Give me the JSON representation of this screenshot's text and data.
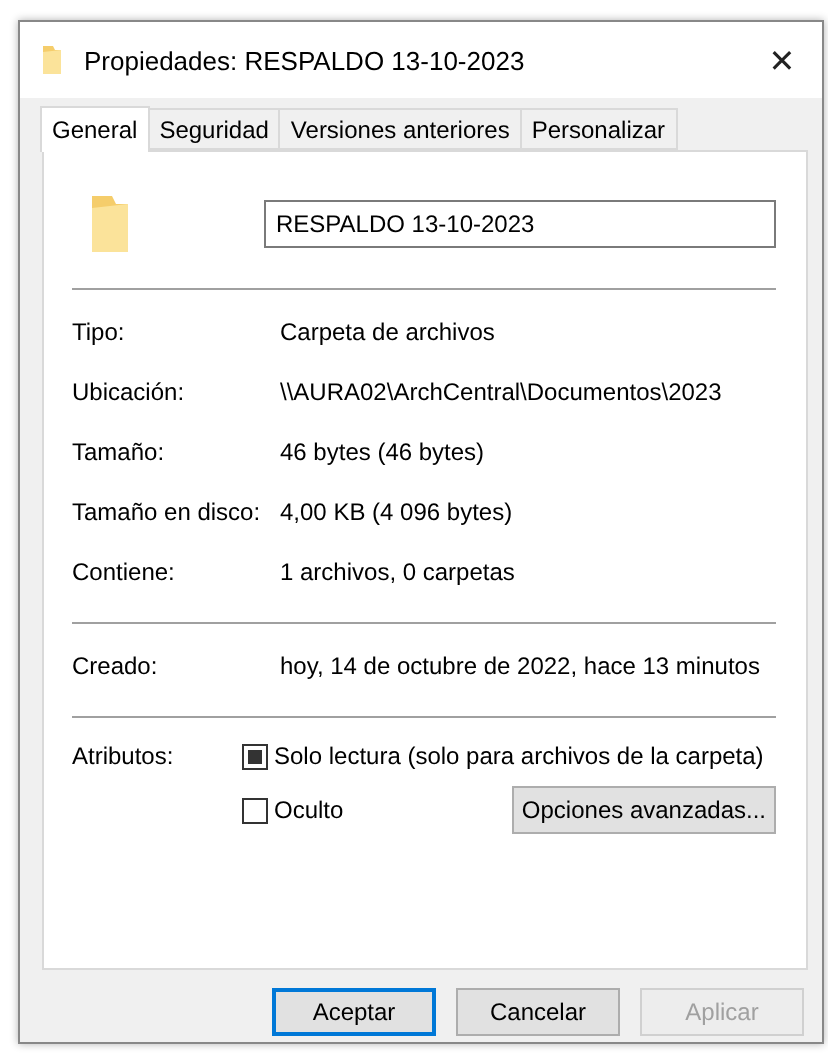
{
  "window": {
    "title": "Propiedades: RESPALDO 13-10-2023",
    "close": "✕"
  },
  "tabs": [
    {
      "label": "General",
      "selected": true
    },
    {
      "label": "Seguridad",
      "selected": false
    },
    {
      "label": "Versiones anteriores",
      "selected": false
    },
    {
      "label": "Personalizar",
      "selected": false
    }
  ],
  "name_field": {
    "value": "RESPALDO 13-10-2023"
  },
  "properties": [
    {
      "label": "Tipo:",
      "value": "Carpeta de archivos"
    },
    {
      "label": "Ubicación:",
      "value": "\\\\AURA02\\ArchCentral\\Documentos\\2023"
    },
    {
      "label": "Tamaño:",
      "value": "46 bytes (46 bytes)"
    },
    {
      "label": "Tamaño en disco:",
      "value": "4,00 KB (4 096 bytes)"
    },
    {
      "label": "Contiene:",
      "value": "1 archivos, 0 carpetas"
    }
  ],
  "dates": [
    {
      "label": "Creado:",
      "value": "hoy, 14 de octubre de 2022, hace 13 minutos"
    }
  ],
  "attributes": {
    "label": "Atributos:",
    "items": [
      {
        "label": "Solo lectura (solo para archivos de la carpeta)",
        "checked": true,
        "mixed": true
      },
      {
        "label": "Oculto",
        "checked": false,
        "mixed": false
      }
    ],
    "advanced_button": "Opciones avanzadas..."
  },
  "buttons": [
    {
      "label": "Aceptar",
      "default": true,
      "disabled": false
    },
    {
      "label": "Cancelar",
      "default": false,
      "disabled": false
    },
    {
      "label": "Aplicar",
      "default": false,
      "disabled": true
    }
  ]
}
